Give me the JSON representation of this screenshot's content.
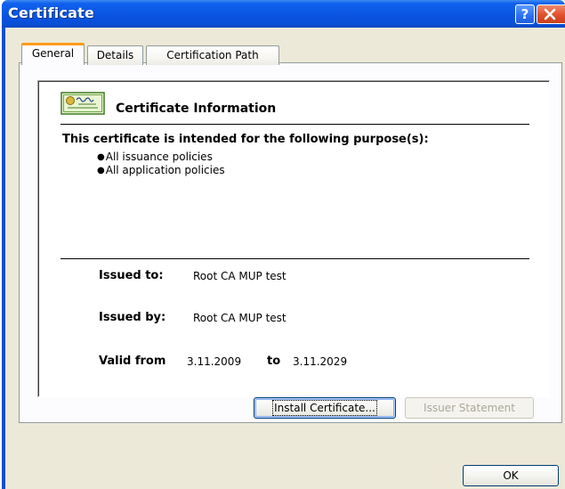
{
  "window": {
    "title": "Certificate",
    "help_glyph": "?",
    "titlebar_color": "#0a54e0",
    "close_color": "#e0502a"
  },
  "tabs": [
    {
      "label": "General",
      "selected": true
    },
    {
      "label": "Details",
      "selected": false
    },
    {
      "label": "Certification Path",
      "selected": false
    }
  ],
  "general": {
    "icon": "certificate-icon",
    "heading": "Certificate Information",
    "purpose_heading": "This certificate is intended for the following purpose(s):",
    "purposes": [
      "All issuance policies",
      "All application policies"
    ],
    "issued_to_label": "Issued to:",
    "issued_to_value": "Root CA MUP test",
    "issued_by_label": "Issued by:",
    "issued_by_value": "Root CA MUP test",
    "valid_from_label": "Valid from",
    "valid_from_value": "3.11.2009",
    "valid_to_label": "to",
    "valid_to_value": "3.11.2029"
  },
  "buttons": {
    "install_certificate": "Install Certificate...",
    "issuer_statement": "Issuer Statement",
    "ok": "OK"
  },
  "accent_color": "#ff9b1a"
}
